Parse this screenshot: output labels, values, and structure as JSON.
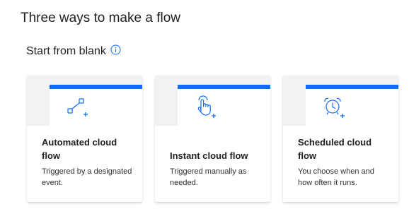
{
  "page": {
    "title": "Three ways to make a flow",
    "section_title": "Start from blank",
    "info_icon": "info-circle-icon"
  },
  "colors": {
    "accent": "#0f6cff",
    "art_background": "#f3f2f1",
    "text": "#201f1e"
  },
  "cards": [
    {
      "title": "Automated cloud flow",
      "description": "Triggered by a designated event.",
      "icon": "automated-flow-icon"
    },
    {
      "title": "Instant cloud flow",
      "description": "Triggered manually as needed.",
      "icon": "touch-hand-icon"
    },
    {
      "title": "Scheduled cloud flow",
      "description": "You choose when and how often it runs.",
      "icon": "alarm-clock-icon"
    }
  ]
}
